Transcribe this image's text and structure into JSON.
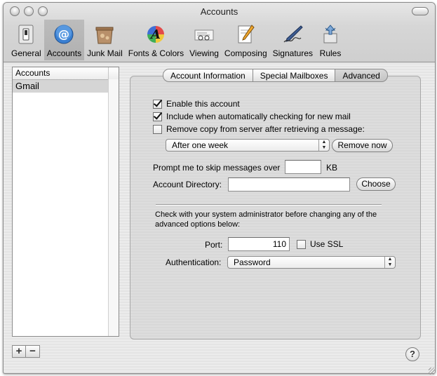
{
  "window": {
    "title": "Accounts"
  },
  "toolbar": {
    "items": [
      {
        "label": "General",
        "icon": "general-switch-icon"
      },
      {
        "label": "Accounts",
        "icon": "at-sign-icon",
        "selected": true
      },
      {
        "label": "Junk Mail",
        "icon": "junk-mail-icon"
      },
      {
        "label": "Fonts & Colors",
        "icon": "fonts-colors-icon"
      },
      {
        "label": "Viewing",
        "icon": "viewing-icon"
      },
      {
        "label": "Composing",
        "icon": "composing-icon"
      },
      {
        "label": "Signatures",
        "icon": "signature-pen-icon"
      },
      {
        "label": "Rules",
        "icon": "rules-icon"
      }
    ]
  },
  "accounts": {
    "header": "Accounts",
    "items": [
      {
        "name": "Gmail",
        "selected": true
      }
    ]
  },
  "controls": {
    "add": "+",
    "remove": "−",
    "help": "?"
  },
  "tabs": [
    {
      "label": "Account Information"
    },
    {
      "label": "Special Mailboxes"
    },
    {
      "label": "Advanced",
      "active": true
    }
  ],
  "advanced": {
    "enable_label": "Enable this account",
    "enable_checked": true,
    "include_label": "Include when automatically checking for new mail",
    "include_checked": true,
    "remove_copy_label": "Remove copy from server after retrieving a message:",
    "remove_copy_checked": false,
    "remove_after_value": "After one week",
    "remove_now_label": "Remove now",
    "prompt_label": "Prompt me to skip messages over",
    "prompt_value": "",
    "prompt_unit": "KB",
    "account_dir_label": "Account Directory:",
    "account_dir_value": "",
    "choose_label": "Choose",
    "note": "Check with your system administrator before changing any of the advanced options below:",
    "port_label": "Port:",
    "port_value": "110",
    "use_ssl_label": "Use SSL",
    "use_ssl_checked": false,
    "auth_label": "Authentication:",
    "auth_value": "Password"
  }
}
